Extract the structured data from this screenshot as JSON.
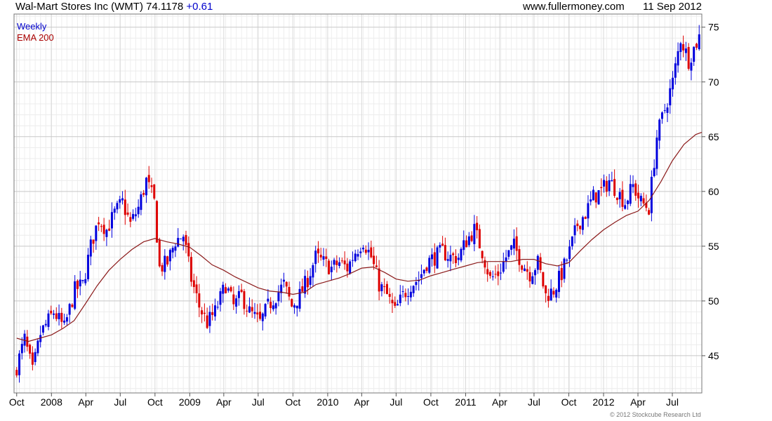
{
  "header": {
    "title": "Wal-Mart Stores Inc (WMT) 74.1178",
    "change": "+0.61",
    "site": "www.fullermoney.com",
    "date": "11 Sep 2012"
  },
  "legend": {
    "weekly": "Weekly",
    "ema": "EMA 200"
  },
  "copyright": "© 2012 Stockcube Research Ltd",
  "colors": {
    "up": "#0000dd",
    "down": "#dd0000",
    "ema": "#8b1a1a",
    "grid": "#d9d9d9"
  },
  "chart_data": {
    "type": "candlestick",
    "title": "Wal-Mart Stores Inc (WMT) 74.1178 +0.61",
    "interval": "Weekly",
    "overlay": "EMA 200",
    "ylim": [
      41.6,
      76.2
    ],
    "yticks": [
      45,
      50,
      55,
      60,
      65,
      70,
      75
    ],
    "y_axis_side": "right",
    "grid": true,
    "legend_position": "top-left",
    "xlim": [
      "2007-09-24",
      "2012-09-17"
    ],
    "xticks": [
      {
        "label": "Oct",
        "date": "2007-10-01"
      },
      {
        "label": "2008",
        "date": "2008-01-01"
      },
      {
        "label": "Apr",
        "date": "2008-04-01"
      },
      {
        "label": "Jul",
        "date": "2008-07-01"
      },
      {
        "label": "Oct",
        "date": "2008-10-01"
      },
      {
        "label": "2009",
        "date": "2009-01-01"
      },
      {
        "label": "Apr",
        "date": "2009-04-01"
      },
      {
        "label": "Jul",
        "date": "2009-07-01"
      },
      {
        "label": "Oct",
        "date": "2009-10-01"
      },
      {
        "label": "2010",
        "date": "2010-01-01"
      },
      {
        "label": "Apr",
        "date": "2010-04-01"
      },
      {
        "label": "Jul",
        "date": "2010-07-01"
      },
      {
        "label": "Oct",
        "date": "2010-10-01"
      },
      {
        "label": "2011",
        "date": "2011-01-01"
      },
      {
        "label": "Apr",
        "date": "2011-04-01"
      },
      {
        "label": "Jul",
        "date": "2011-07-01"
      },
      {
        "label": "Oct",
        "date": "2011-10-01"
      },
      {
        "label": "2012",
        "date": "2012-01-01"
      },
      {
        "label": "Apr",
        "date": "2012-04-01"
      },
      {
        "label": "Jul",
        "date": "2012-07-01"
      }
    ],
    "close_path": [
      [
        "2007-10-01",
        44.0
      ],
      [
        "2007-10-22",
        46.5
      ],
      [
        "2007-11-12",
        43.5
      ],
      [
        "2007-12-03",
        47.0
      ],
      [
        "2008-01-07",
        49.0
      ],
      [
        "2008-02-04",
        47.5
      ],
      [
        "2008-03-03",
        51.0
      ],
      [
        "2008-03-24",
        51.5
      ],
      [
        "2008-04-14",
        55.0
      ],
      [
        "2008-05-05",
        57.5
      ],
      [
        "2008-05-26",
        56.5
      ],
      [
        "2008-06-16",
        58.0
      ],
      [
        "2008-07-07",
        59.0
      ],
      [
        "2008-07-28",
        57.0
      ],
      [
        "2008-08-18",
        58.5
      ],
      [
        "2008-09-08",
        61.0
      ],
      [
        "2008-09-29",
        59.0
      ],
      [
        "2008-10-13",
        53.0
      ],
      [
        "2008-11-03",
        53.5
      ],
      [
        "2008-11-24",
        55.5
      ],
      [
        "2008-12-15",
        56.0
      ],
      [
        "2009-01-05",
        52.0
      ],
      [
        "2009-01-26",
        49.5
      ],
      [
        "2009-02-16",
        48.0
      ],
      [
        "2009-03-09",
        49.0
      ],
      [
        "2009-04-06",
        51.5
      ],
      [
        "2009-04-27",
        49.5
      ],
      [
        "2009-05-18",
        50.5
      ],
      [
        "2009-06-08",
        49.0
      ],
      [
        "2009-07-06",
        48.0
      ],
      [
        "2009-07-27",
        49.5
      ],
      [
        "2009-08-17",
        50.5
      ],
      [
        "2009-09-07",
        51.5
      ],
      [
        "2009-09-28",
        49.5
      ],
      [
        "2009-10-19",
        50.5
      ],
      [
        "2009-11-09",
        52.0
      ],
      [
        "2009-11-30",
        54.0
      ],
      [
        "2009-12-21",
        53.5
      ],
      [
        "2010-01-11",
        53.0
      ],
      [
        "2010-02-01",
        53.5
      ],
      [
        "2010-02-22",
        53.0
      ],
      [
        "2010-03-15",
        54.5
      ],
      [
        "2010-04-05",
        55.5
      ],
      [
        "2010-04-26",
        54.0
      ],
      [
        "2010-05-17",
        51.5
      ],
      [
        "2010-06-07",
        50.5
      ],
      [
        "2010-06-28",
        49.0
      ],
      [
        "2010-07-19",
        50.5
      ],
      [
        "2010-08-09",
        51.5
      ],
      [
        "2010-08-30",
        52.0
      ],
      [
        "2010-09-20",
        53.5
      ],
      [
        "2010-10-11",
        54.0
      ],
      [
        "2010-11-01",
        54.5
      ],
      [
        "2010-11-22",
        54.0
      ],
      [
        "2010-12-13",
        54.0
      ],
      [
        "2011-01-03",
        55.5
      ],
      [
        "2011-01-24",
        56.5
      ],
      [
        "2011-02-14",
        54.5
      ],
      [
        "2011-03-07",
        52.0
      ],
      [
        "2011-03-28",
        52.5
      ],
      [
        "2011-04-18",
        54.0
      ],
      [
        "2011-05-09",
        55.0
      ],
      [
        "2011-05-30",
        53.5
      ],
      [
        "2011-06-20",
        52.5
      ],
      [
        "2011-07-11",
        53.5
      ],
      [
        "2011-08-01",
        50.5
      ],
      [
        "2011-08-22",
        51.0
      ],
      [
        "2011-09-12",
        52.5
      ],
      [
        "2011-10-03",
        54.5
      ],
      [
        "2011-10-24",
        57.0
      ],
      [
        "2011-11-14",
        58.0
      ],
      [
        "2011-12-05",
        59.5
      ],
      [
        "2011-12-26",
        60.0
      ],
      [
        "2012-01-16",
        61.0
      ],
      [
        "2012-02-06",
        60.0
      ],
      [
        "2012-02-27",
        59.0
      ],
      [
        "2012-03-19",
        60.5
      ],
      [
        "2012-04-09",
        59.0
      ],
      [
        "2012-04-30",
        58.5
      ],
      [
        "2012-05-21",
        65.0
      ],
      [
        "2012-06-11",
        67.5
      ],
      [
        "2012-07-02",
        70.0
      ],
      [
        "2012-07-23",
        74.0
      ],
      [
        "2012-08-13",
        72.0
      ],
      [
        "2012-09-10",
        74.1178
      ]
    ],
    "ema_200": [
      [
        "2007-10-01",
        46.6
      ],
      [
        "2007-11-01",
        46.3
      ],
      [
        "2007-12-01",
        46.6
      ],
      [
        "2008-01-01",
        46.9
      ],
      [
        "2008-02-01",
        47.5
      ],
      [
        "2008-03-01",
        48.2
      ],
      [
        "2008-04-01",
        49.8
      ],
      [
        "2008-05-01",
        51.4
      ],
      [
        "2008-06-01",
        52.8
      ],
      [
        "2008-07-01",
        53.8
      ],
      [
        "2008-08-01",
        54.7
      ],
      [
        "2008-09-01",
        55.4
      ],
      [
        "2008-10-01",
        55.7
      ],
      [
        "2008-11-01",
        55.4
      ],
      [
        "2008-12-01",
        55.2
      ],
      [
        "2009-01-01",
        54.9
      ],
      [
        "2009-02-01",
        54.1
      ],
      [
        "2009-03-01",
        53.3
      ],
      [
        "2009-04-01",
        52.8
      ],
      [
        "2009-05-01",
        52.2
      ],
      [
        "2009-06-01",
        51.7
      ],
      [
        "2009-07-01",
        51.2
      ],
      [
        "2009-08-01",
        50.9
      ],
      [
        "2009-09-01",
        50.8
      ],
      [
        "2009-10-01",
        50.6
      ],
      [
        "2009-11-01",
        50.8
      ],
      [
        "2009-12-01",
        51.5
      ],
      [
        "2010-01-01",
        51.8
      ],
      [
        "2010-02-01",
        52.1
      ],
      [
        "2010-03-01",
        52.5
      ],
      [
        "2010-04-01",
        53.0
      ],
      [
        "2010-05-01",
        53.1
      ],
      [
        "2010-06-01",
        52.6
      ],
      [
        "2010-07-01",
        52.0
      ],
      [
        "2010-08-01",
        51.8
      ],
      [
        "2010-09-01",
        51.9
      ],
      [
        "2010-10-01",
        52.3
      ],
      [
        "2010-11-01",
        52.6
      ],
      [
        "2010-12-01",
        52.9
      ],
      [
        "2011-01-01",
        53.2
      ],
      [
        "2011-02-01",
        53.5
      ],
      [
        "2011-03-01",
        53.6
      ],
      [
        "2011-04-01",
        53.6
      ],
      [
        "2011-05-01",
        53.6
      ],
      [
        "2011-06-01",
        53.8
      ],
      [
        "2011-07-01",
        53.8
      ],
      [
        "2011-08-01",
        53.4
      ],
      [
        "2011-09-01",
        53.2
      ],
      [
        "2011-10-01",
        53.5
      ],
      [
        "2011-11-01",
        54.6
      ],
      [
        "2011-12-01",
        55.6
      ],
      [
        "2012-01-01",
        56.5
      ],
      [
        "2012-02-01",
        57.2
      ],
      [
        "2012-03-01",
        57.8
      ],
      [
        "2012-04-01",
        58.2
      ],
      [
        "2012-05-01",
        59.2
      ],
      [
        "2012-06-01",
        60.9
      ],
      [
        "2012-07-01",
        62.8
      ],
      [
        "2012-08-01",
        64.3
      ],
      [
        "2012-09-01",
        65.2
      ],
      [
        "2012-09-17",
        65.4
      ]
    ]
  }
}
